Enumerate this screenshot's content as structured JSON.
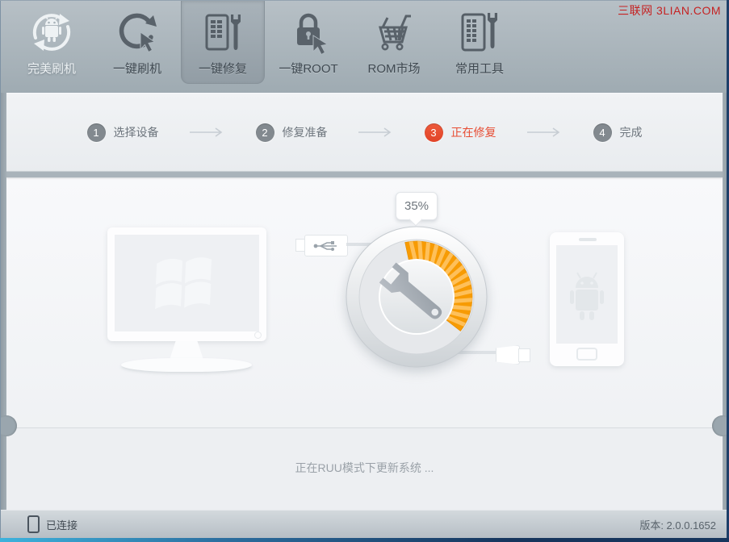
{
  "watermark": "三联网 3LIAN.COM",
  "toolbar": {
    "items": [
      {
        "label": "完美刷机"
      },
      {
        "label": "一键刷机"
      },
      {
        "label": "一键修复"
      },
      {
        "label": "一键ROOT"
      },
      {
        "label": "ROM市场"
      },
      {
        "label": "常用工具"
      }
    ]
  },
  "steps": {
    "active_index": 2,
    "items": [
      {
        "num": "1",
        "label": "选择设备"
      },
      {
        "num": "2",
        "label": "修复准备"
      },
      {
        "num": "3",
        "label": "正在修复"
      },
      {
        "num": "4",
        "label": "完成"
      }
    ]
  },
  "progress": {
    "percent": 35,
    "label": "35%"
  },
  "status_message": "正在RUU模式下更新系统 ...",
  "footer": {
    "connection_status": "已连接",
    "version": "版本: 2.0.0.1652"
  },
  "colors": {
    "progress_orange": "#f79b04",
    "progress_stripe": "#fec05a",
    "active_step_red": "#e74c33"
  }
}
